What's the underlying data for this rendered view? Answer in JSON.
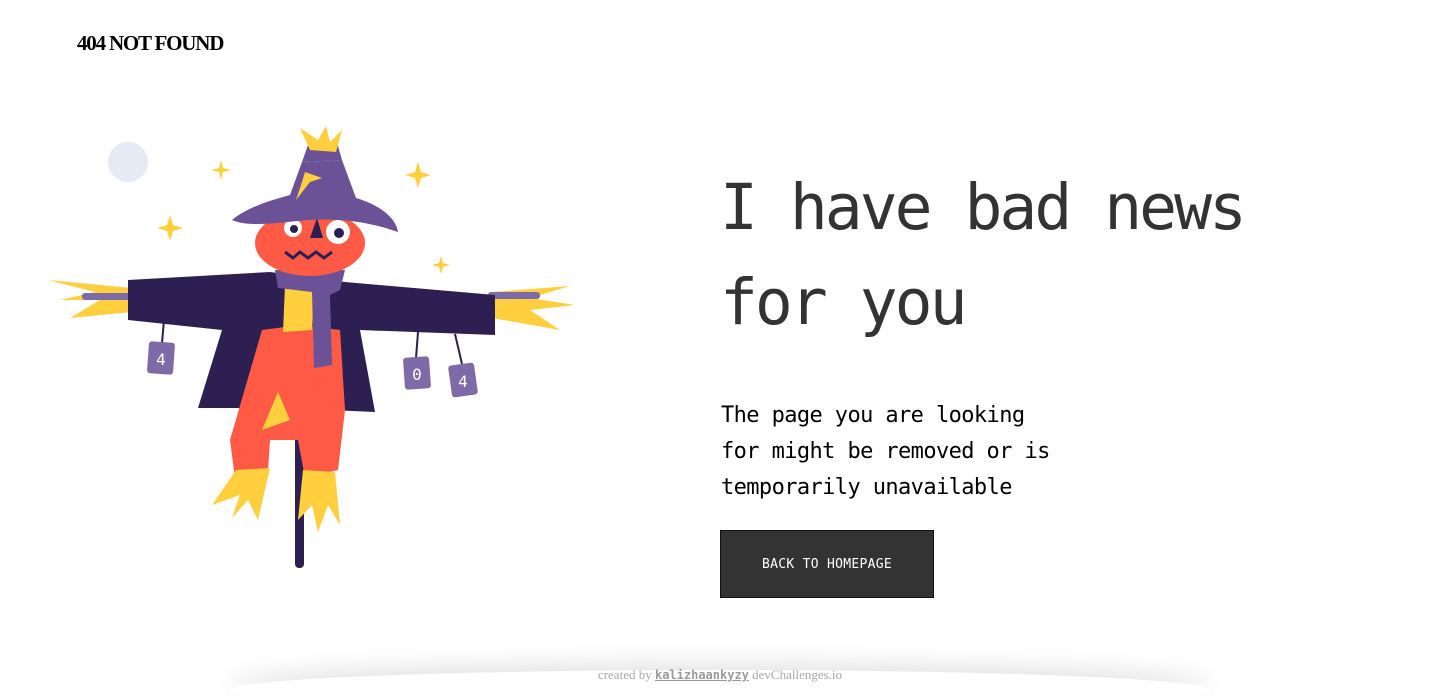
{
  "header": {
    "brand": "404 NOT FOUND"
  },
  "illustration": {
    "subject": "scarecrow",
    "can_labels": [
      "4",
      "0",
      "4"
    ]
  },
  "main": {
    "headline_line1": "I have bad news",
    "headline_line2": "for you",
    "message_line1": "The page you are looking",
    "message_line2": "for might be removed or is",
    "message_line3": "temporarily unavailable",
    "button_label": "BACK TO HOMEPAGE"
  },
  "footer": {
    "prefix": "created by",
    "author": "kalizhaankyzy",
    "suffix": "devChallenges.io"
  },
  "colors": {
    "text_dark": "#333333",
    "button_bg": "#333333",
    "button_text": "#ffffff",
    "hat_purple": "#6B5196",
    "coat_navy": "#2E1F52",
    "pumpkin_red": "#FF5A45",
    "straw_yellow": "#FFCF3D",
    "moon": "#E5EAF5"
  }
}
